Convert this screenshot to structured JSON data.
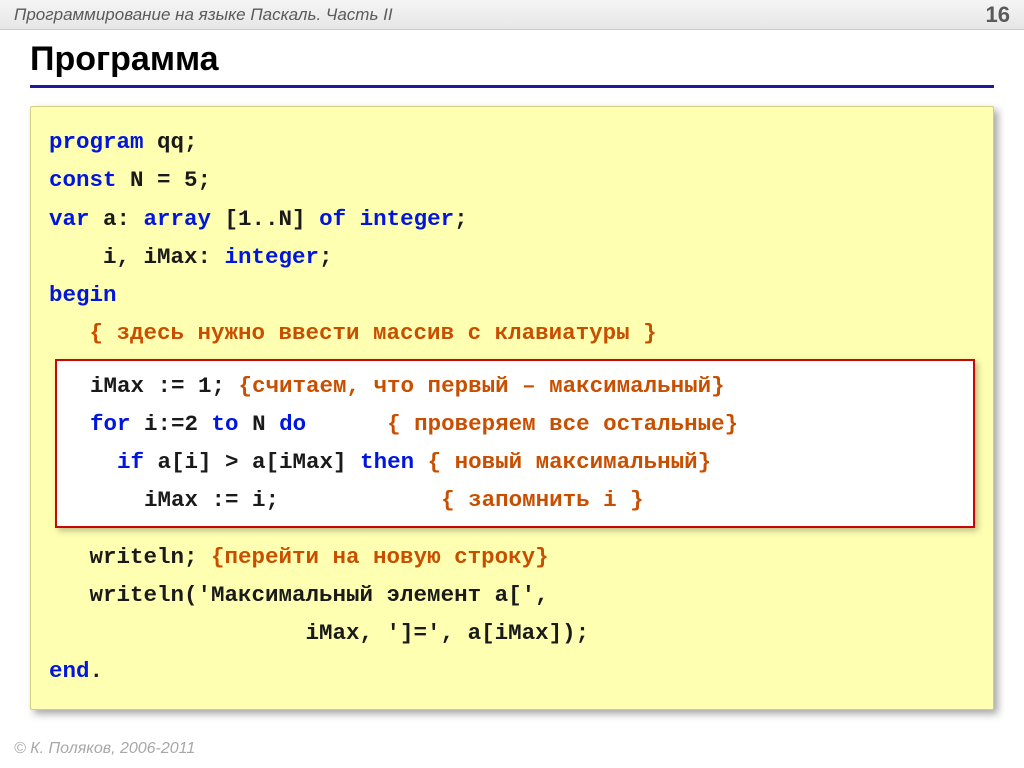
{
  "header": {
    "title": "Программирование на языке Паскаль. Часть II",
    "page_number": "16"
  },
  "slide": {
    "title": "Программа"
  },
  "code": {
    "l1_kw": "program",
    "l1_rest": " qq;",
    "l2_kw": "const",
    "l2_rest": " N = 5;",
    "l3_kw": "var",
    "l3_rest1": " a: ",
    "l3_kw2": "array",
    "l3_rest2": " [1..N] ",
    "l3_kw3": "of",
    "l3_rest3": " ",
    "l3_kw4": "integer",
    "l3_rest4": ";",
    "l4_rest": "    i, iMax: ",
    "l4_kw": "integer",
    "l4_rest2": ";",
    "l5_kw": "begin",
    "l6_comment": "   { здесь нужно ввести массив с клавиатуры }",
    "h1_code": "  iMax := 1; ",
    "h1_comment": "{считаем, что первый – максимальный}",
    "h2_kw1": "for",
    "h2_code1": "  ",
    "h2_mid": " i:=2 ",
    "h2_kw2": "to",
    "h2_mid2": " N ",
    "h2_kw3": "do",
    "h2_gap": "      ",
    "h2_comment": "{ проверяем все остальные}",
    "h3_indent": "    ",
    "h3_kw1": "if",
    "h3_mid": " a[i] > a[iMax] ",
    "h3_kw2": "then",
    "h3_sp": " ",
    "h3_comment": "{ новый максимальный}",
    "h4_code": "      iMax := i;            ",
    "h4_comment": "{ запомнить i }",
    "l7_code": "   writeln; ",
    "l7_comment": "{перейти на новую строку}",
    "l8_line": "   writeln('Максимальный элемент a[',",
    "l9_line": "                   iMax, ']=', a[iMax]);",
    "l10_kw": "end",
    "l10_rest": "."
  },
  "footer": {
    "copyright": "© К. Поляков, 2006-2011"
  }
}
